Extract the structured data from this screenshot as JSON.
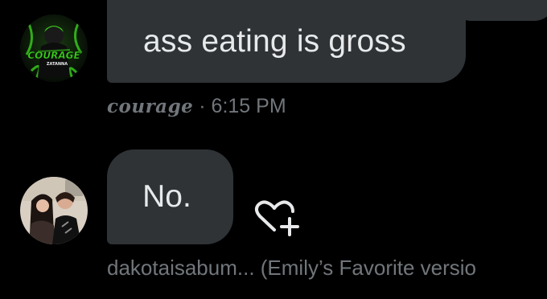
{
  "messages": [
    {
      "text": "ass eating is gross",
      "sender": "courage",
      "separator": " ·",
      "time": "6:15 PM",
      "avatar_text": "COURAGE",
      "avatar_subtext": "ZATANNA"
    },
    {
      "text": "No.",
      "meta_text": "dakotaisabum... (Emily’s Favorite versio"
    }
  ],
  "icons": {
    "react": "heart-plus-icon"
  },
  "colors": {
    "background": "#000000",
    "bubble": "#2f3336",
    "text": "#e7e9ea",
    "meta": "#71767b",
    "avatar_green": "#3bd11d"
  }
}
